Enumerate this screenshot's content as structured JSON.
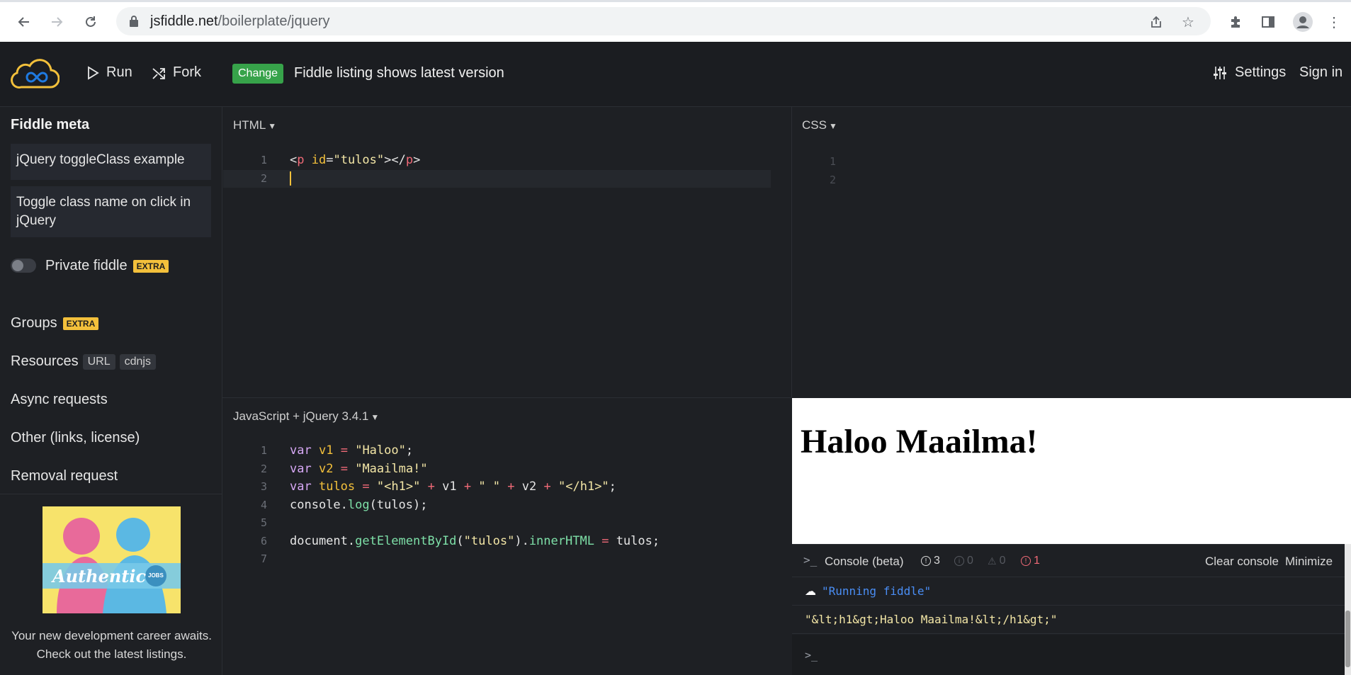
{
  "browser": {
    "url_host": "jsfiddle.net",
    "url_path": "/boilerplate/jquery"
  },
  "header": {
    "run_label": "Run",
    "fork_label": "Fork",
    "change_badge": "Change",
    "version_text": "Fiddle listing shows latest version",
    "settings_label": "Settings",
    "signin_label": "Sign in"
  },
  "sidebar": {
    "title": "Fiddle meta",
    "fiddle_title": "jQuery toggleClass example",
    "fiddle_description": "Toggle class name on click in jQuery",
    "private_label": "Private fiddle",
    "extra_badge": "EXTRA",
    "groups_label": "Groups",
    "resources_label": "Resources",
    "resources_tags": [
      "URL",
      "cdnjs"
    ],
    "async_label": "Async requests",
    "other_label": "Other (links, license)",
    "removal_label": "Removal request",
    "ad_brand": "Authentic",
    "ad_badge": "JOBS",
    "ad_text": "Your new development career awaits. Check out the latest listings."
  },
  "panels": {
    "html_label": "HTML",
    "css_label": "CSS",
    "js_label": "JavaScript + jQuery 3.4.1"
  },
  "html_code": {
    "line_numbers": [
      "1",
      "2"
    ],
    "line1": {
      "open": "<",
      "tag": "p",
      "attr": " id",
      "eq": "=",
      "val": "\"tulos\"",
      "close": "></",
      "tag2": "p",
      "end": ">"
    }
  },
  "css_code": {
    "line_numbers": [
      "1",
      "2"
    ]
  },
  "js_code": {
    "line_numbers": [
      "1",
      "2",
      "3",
      "4",
      "5",
      "6",
      "7"
    ],
    "line1": {
      "kw": "var",
      "var": "v1",
      "op": "=",
      "str": "\"Haloo\"",
      "end": ";"
    },
    "line2": {
      "kw": "var",
      "var": "v2",
      "op": "=",
      "str": "\"Maailma!\""
    },
    "line3": {
      "kw": "var",
      "var": "tulos",
      "op": "=",
      "s1": "\"<h1>\"",
      "p1": "+",
      "v1": "v1",
      "p2": "+",
      "s2": "\" \"",
      "p3": "+",
      "v2": "v2",
      "p4": "+",
      "s3": "\"</h1>\"",
      "end": ";"
    },
    "line4": {
      "obj": "console.",
      "fn": "log",
      "args": "(tulos);"
    },
    "line6": {
      "obj": "document.",
      "fn": "getElementById",
      "open": "(",
      "str": "\"tulos\"",
      "close": ").",
      "prop": "innerHTML",
      "op": "=",
      "rest": "tulos;"
    }
  },
  "result": {
    "heading": "Haloo Maailma!"
  },
  "console": {
    "title": "Console (beta)",
    "count_all": "3",
    "count_info": "0",
    "count_warn": "0",
    "count_error": "1",
    "clear_label": "Clear console",
    "minimize_label": "Minimize",
    "running_msg": "\"Running fiddle\"",
    "log_output": "\"&lt;h1&gt;Haloo Maailma!&lt;/h1&gt;\"",
    "prompt": ">_"
  },
  "colors": {
    "accent_green": "#37a34a",
    "extra_badge": "#f3c03b",
    "error_red": "#f06a77"
  }
}
